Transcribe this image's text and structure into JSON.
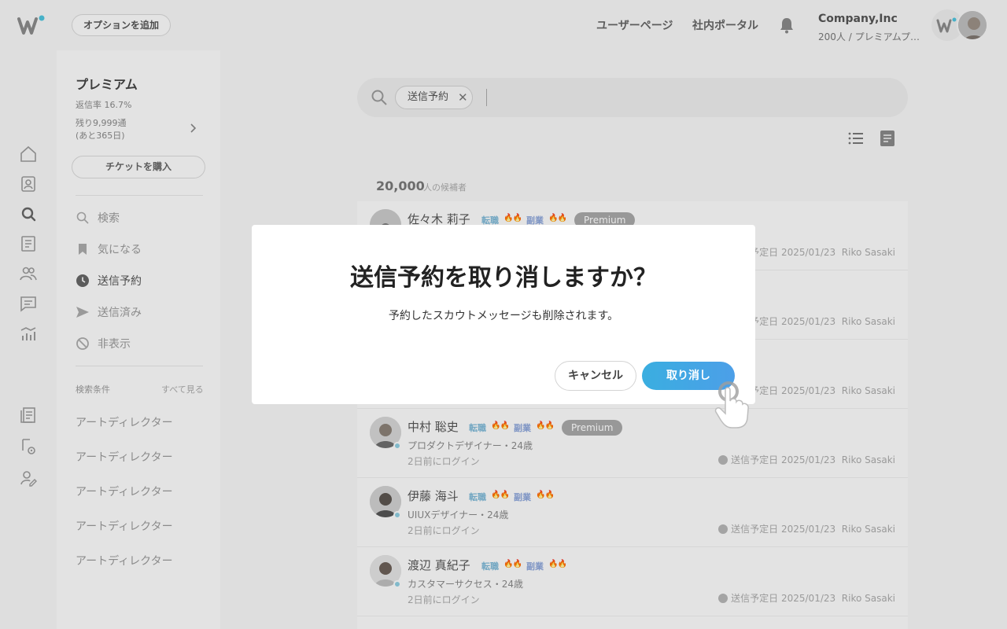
{
  "header": {
    "option_button": "オプションを追加",
    "nav": [
      "ユーザーページ",
      "社内ポータル"
    ],
    "company_name": "Company,Inc",
    "company_sub": "200人 / プレミアムプラ..."
  },
  "rail_icons": [
    "home-icon",
    "profile-icon",
    "search-icon",
    "document-icon",
    "people-icon",
    "chat-icon",
    "analytics-icon",
    "report-icon",
    "settings-doc-icon",
    "user-edit-icon"
  ],
  "plan": {
    "title": "プレミアム",
    "reply_rate": "返信率 16.7%",
    "remaining_1": "残り9,999通",
    "remaining_2": "(あと365日)",
    "ticket_button": "チケットを購入"
  },
  "menu": [
    {
      "label": "検索",
      "icon": "search-icon",
      "active": false
    },
    {
      "label": "気になる",
      "icon": "bookmark-icon",
      "active": false
    },
    {
      "label": "送信予約",
      "icon": "clock-icon",
      "active": true
    },
    {
      "label": "送信済み",
      "icon": "send-icon",
      "active": false
    },
    {
      "label": "非表示",
      "icon": "hidden-icon",
      "active": false
    }
  ],
  "conditions": {
    "label": "検索条件",
    "see_all": "すべて見る",
    "items": [
      "アートディレクター",
      "アートディレクター",
      "アートディレクター",
      "アートディレクター",
      "アートディレクター"
    ]
  },
  "search": {
    "chip": "送信予約"
  },
  "results": {
    "count": "20,000",
    "unit": "人の候補者"
  },
  "candidates": [
    {
      "name": "佐々木 莉子",
      "tag1": "転職",
      "tag2": "副業",
      "badge": "Premium",
      "role": "",
      "login": "",
      "scheduled": "送信予定日 2025/01/23",
      "owner": "Riko Sasaki"
    },
    {
      "name": "",
      "tag1": "",
      "tag2": "",
      "badge": "",
      "role": "",
      "login": "",
      "scheduled": "送信予定日 2025/01/23",
      "owner": "Riko Sasaki"
    },
    {
      "name": "",
      "tag1": "",
      "tag2": "",
      "badge": "",
      "role": "",
      "login": "",
      "scheduled": "送信予定日 2025/01/23",
      "owner": "Riko Sasaki"
    },
    {
      "name": "中村 聡史",
      "tag1": "転職",
      "tag2": "副業",
      "badge": "Premium",
      "role": "プロダクトデザイナー・24歳",
      "login": "2日前にログイン",
      "scheduled": "送信予定日 2025/01/23",
      "owner": "Riko Sasaki"
    },
    {
      "name": "伊藤 海斗",
      "tag1": "転職",
      "tag2": "副業",
      "badge": "",
      "role": "UIUXデザイナー・24歳",
      "login": "2日前にログイン",
      "scheduled": "送信予定日 2025/01/23",
      "owner": "Riko Sasaki"
    },
    {
      "name": "渡辺 真紀子",
      "tag1": "転職",
      "tag2": "副業",
      "badge": "",
      "role": "カスタマーサクセス・24歳",
      "login": "2日前にログイン",
      "scheduled": "送信予定日 2025/01/23",
      "owner": "Riko Sasaki"
    }
  ],
  "modal": {
    "title": "送信予約を取り消しますか？",
    "message": "予約したスカウトメッセージも削除されます。",
    "cancel": "キャンセル",
    "confirm": "取り消し"
  },
  "colors": {
    "accent": "#3aaee0",
    "brand_dot": "#4fc3dc",
    "premium_badge": "#a8a8a8"
  }
}
